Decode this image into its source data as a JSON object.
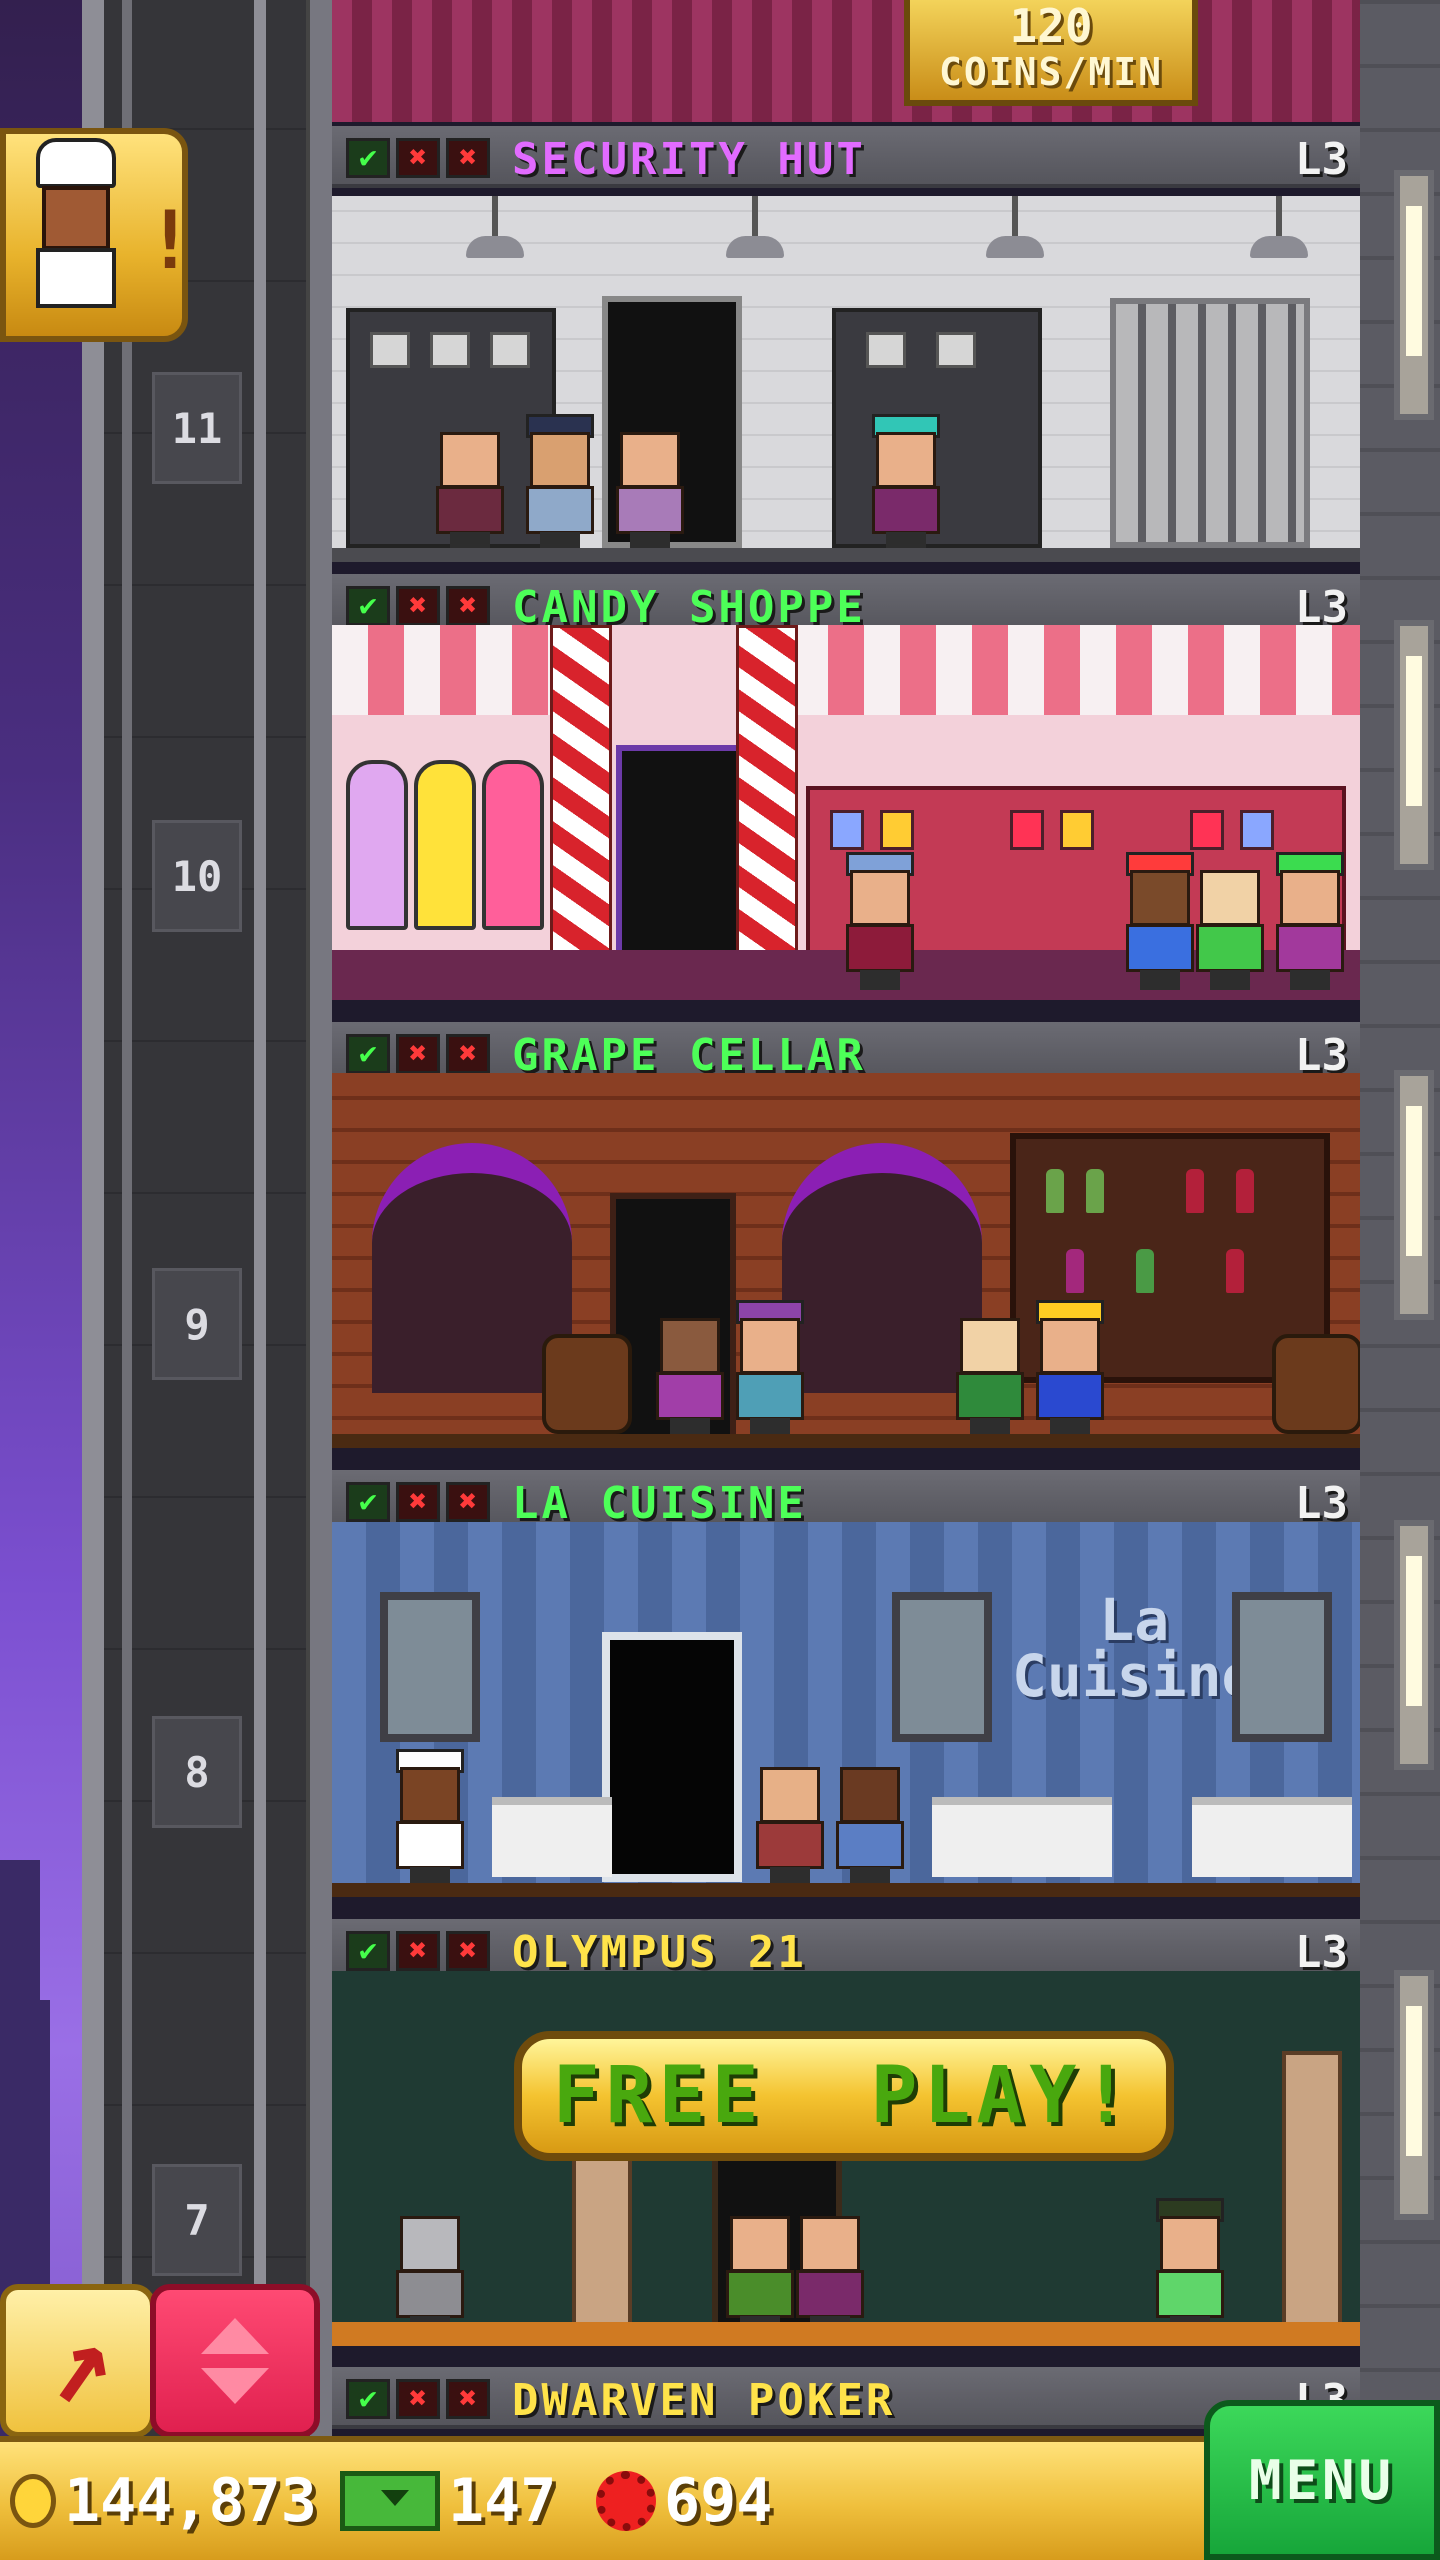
{
  "top_banner": {
    "coins_value": "120",
    "coins_unit": "COINS/MIN"
  },
  "shaft": {
    "floor_numbers": [
      "11",
      "10",
      "9",
      "8",
      "7"
    ]
  },
  "floors": [
    {
      "name": "SECURITY HUT",
      "level": "L3",
      "name_color": "#e26bff"
    },
    {
      "name": "CANDY SHOPPE",
      "level": "L3",
      "name_color": "#4dff58"
    },
    {
      "name": "GRAPE CELLAR",
      "level": "L3",
      "name_color": "#4dff58"
    },
    {
      "name": "LA CUISINE",
      "level": "L3",
      "name_color": "#4dff58"
    },
    {
      "name": "OLYMPUS 21",
      "level": "L3",
      "name_color": "#ffe34a"
    },
    {
      "name": "DWARVEN POKER",
      "level": "L3",
      "name_color": "#ffe34a"
    }
  ],
  "rooms": {
    "cuisine_sign": "La\nCuisine",
    "free_play_label": "FREE  PLAY!"
  },
  "elevator": {
    "alert": "!"
  },
  "status": {
    "coins": "144,873",
    "bux": "147",
    "gems": "694"
  },
  "menu_label": "MENU",
  "colors": {
    "check": "#45ff4b",
    "cross": "#ff3a3a",
    "menu_green": "#22bb44",
    "status_gold": "#efbf3c"
  }
}
